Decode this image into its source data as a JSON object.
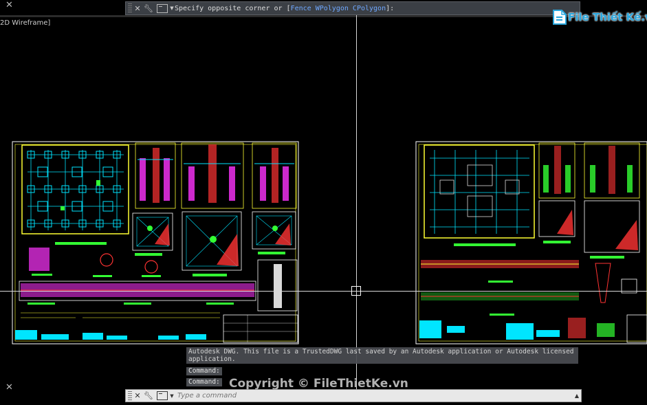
{
  "viewport": {
    "view_label": "2D Wireframe]"
  },
  "top_command_bar": {
    "prompt_prefix": "Specify opposite corner or [",
    "options": [
      "Fence",
      "WPolygon",
      "CPolygon"
    ],
    "option_separator": " ",
    "prompt_suffix": "]:",
    "close_icon": "close-icon",
    "customize_icon": "wrench-icon"
  },
  "command_history": {
    "message": "Autodesk DWG.  This file is a TrustedDWG last saved by an Autodesk application or Autodesk licensed application.",
    "lines": [
      "Command:",
      "Command:"
    ]
  },
  "bottom_command_bar": {
    "placeholder": "Type a command"
  },
  "watermark": {
    "logo_text": "File Thiết Kế.vn",
    "copyright": "Copyright © FileThietKe.vn"
  },
  "colors": {
    "background": "#000000",
    "cad_cyan": "#00e5ff",
    "cad_yellow": "#ffff33",
    "cad_magenta": "#ff33ff",
    "cad_green": "#33ff33",
    "cad_red": "#ff3333",
    "brand_blue": "#2aa7de"
  }
}
